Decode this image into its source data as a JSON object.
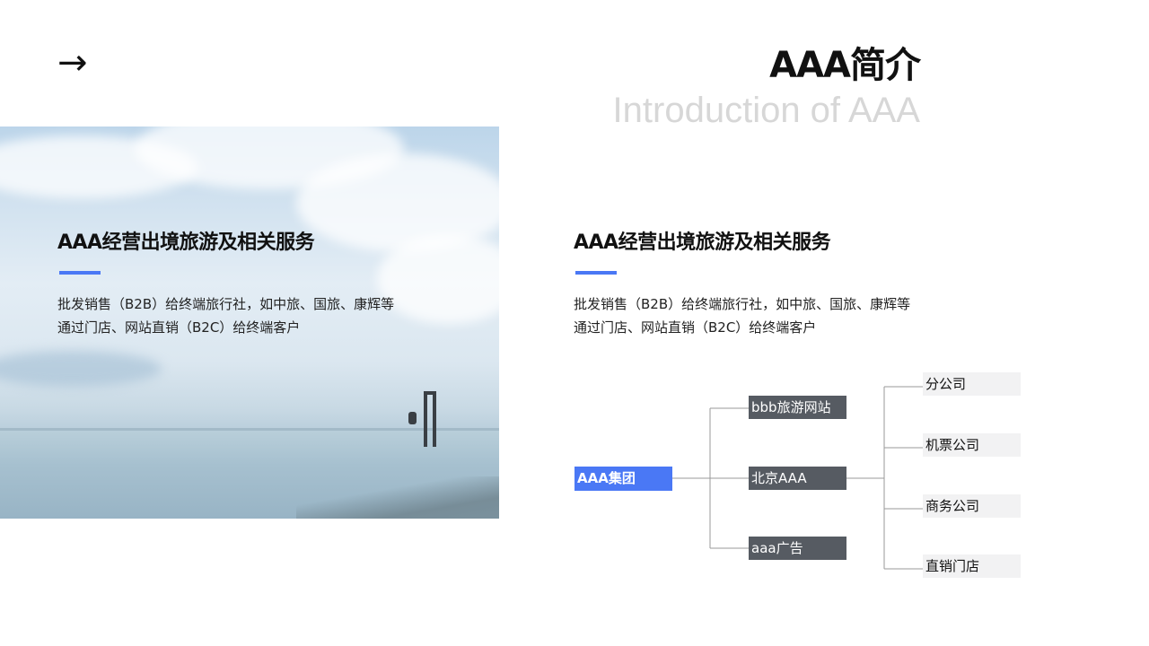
{
  "header": {
    "arrow": "→",
    "title": "AAA简介",
    "subtitle": "Introduction of AAA"
  },
  "left_card": {
    "heading": "AAA经营出境旅游及相关服务",
    "lines": [
      "批发销售（B2B）给终端旅行社，如中旅、国旅、康辉等",
      "通过门店、网站直销（B2C）给终端客户"
    ]
  },
  "right_card": {
    "heading": "AAA经营出境旅游及相关服务",
    "lines": [
      "批发销售（B2B）给终端旅行社，如中旅、国旅、康辉等",
      "通过门店、网站直销（B2C）给终端客户"
    ]
  },
  "org_chart": {
    "root": "AAA集团",
    "level1": [
      "bbb旅游网站",
      "北京AAA",
      "aaa广告"
    ],
    "level2": [
      "分公司",
      "机票公司",
      "商务公司",
      "直销门店"
    ]
  },
  "colors": {
    "accent": "#4a78f5",
    "mid_node": "#565b62",
    "leaf_node": "#f2f2f3",
    "subtitle": "#d7d7d7"
  }
}
